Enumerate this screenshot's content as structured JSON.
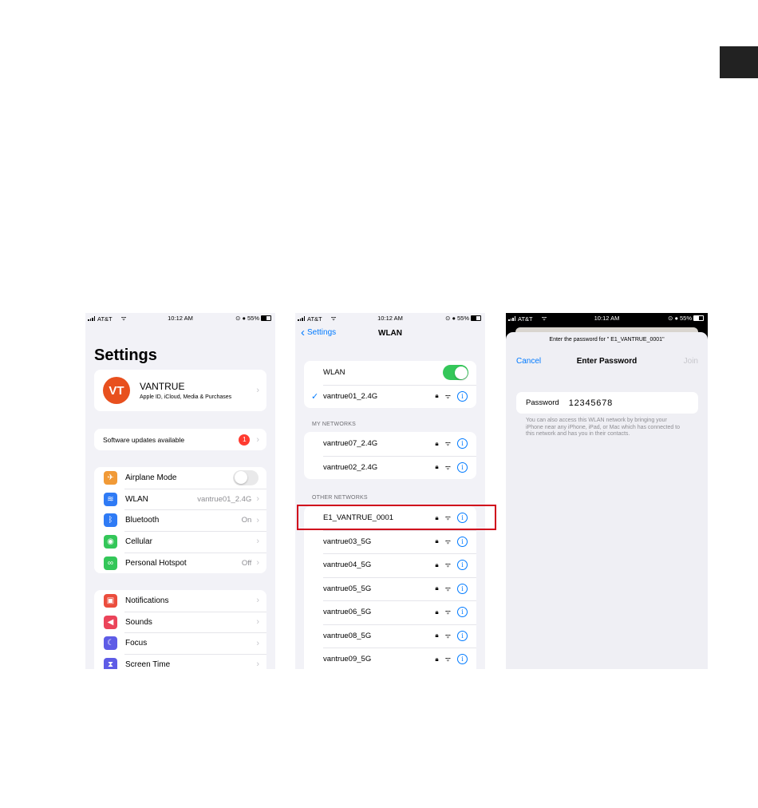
{
  "status": {
    "carrier": "AT&T",
    "time": "10:12 AM",
    "battery": "55%"
  },
  "settings": {
    "title": "Settings",
    "profile": {
      "initials": "VT",
      "name": "VANTRUE",
      "subtitle": "Apple ID, iCloud, Media & Purchases"
    },
    "updates": {
      "label": "Software updates available",
      "badge": "1"
    },
    "connectivity": [
      {
        "label": "Airplane Mode",
        "value": "",
        "color": "#f19a37",
        "glyph": "✈"
      },
      {
        "label": "WLAN",
        "value": "vantrue01_2.4G",
        "color": "#2f7bf5",
        "glyph": "≋"
      },
      {
        "label": "Bluetooth",
        "value": "On",
        "color": "#2f7bf5",
        "glyph": "ᛒ"
      },
      {
        "label": "Cellular",
        "value": "",
        "color": "#34c759",
        "glyph": "◉"
      },
      {
        "label": "Personal Hotspot",
        "value": "Off",
        "color": "#34c759",
        "glyph": "∞"
      }
    ],
    "general": [
      {
        "label": "Notifications",
        "color": "#eb4d3d",
        "glyph": "▣"
      },
      {
        "label": "Sounds",
        "color": "#eb445a",
        "glyph": "◀"
      },
      {
        "label": "Focus",
        "color": "#5e5ce6",
        "glyph": "☾"
      },
      {
        "label": "Screen Time",
        "color": "#5e5ce6",
        "glyph": "⧗"
      }
    ]
  },
  "wlan": {
    "back_label": "Settings",
    "title": "WLAN",
    "toggle_label": "WLAN",
    "connected": "vantrue01_2.4G",
    "my_networks_header": "MY NETWORKS",
    "my_networks": [
      "vantrue07_2.4G",
      "vantrue02_2.4G"
    ],
    "other_networks_header": "OTHER NETWORKS",
    "other_networks": [
      "E1_VANTRUE_0001",
      "vantrue03_5G",
      "vantrue04_5G",
      "vantrue05_5G",
      "vantrue06_5G",
      "vantrue08_5G",
      "vantrue09_5G"
    ]
  },
  "password": {
    "prompt": "Enter the password for \" E1_VANTRUE_0001\"",
    "cancel": "Cancel",
    "title": "Enter Password",
    "join": "Join",
    "field_label": "Password",
    "field_value": "12345678",
    "note": "You can also access this WLAN network by bringing your iPhone near any iPhone, iPad, or Mac which has connected to this network and has you in their contacts."
  }
}
